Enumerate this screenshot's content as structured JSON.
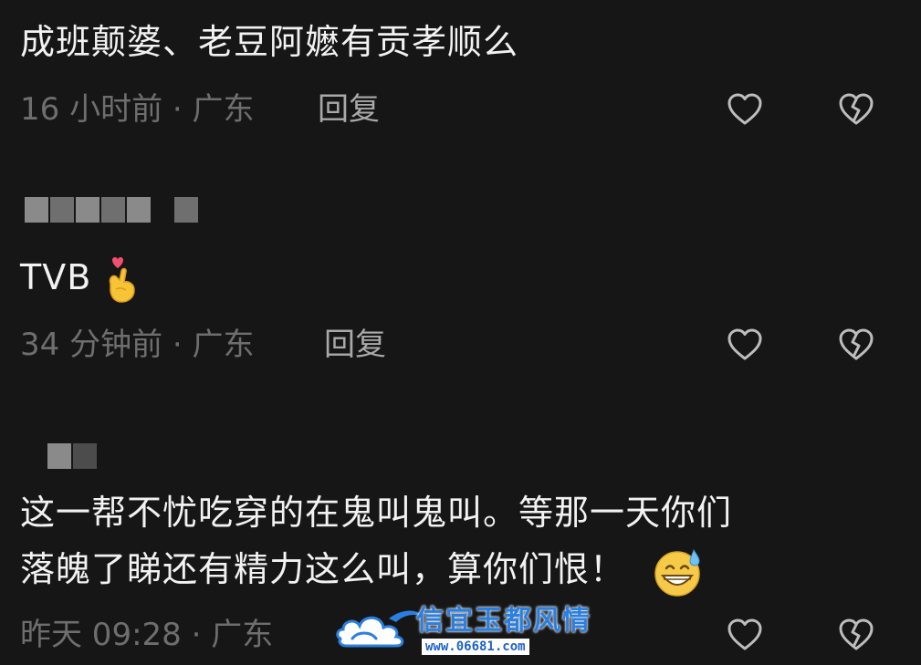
{
  "comments": [
    {
      "text": "成班颠婆、老豆阿嬷有贡孝顺么",
      "meta": "16 小时前 · 广东",
      "reply_label": "回复"
    },
    {
      "text": "TVB",
      "emoji": "heart-finger-emoji",
      "meta": "34 分钟前 · 广东",
      "reply_label": "回复"
    },
    {
      "text_line1": "这一帮不忧吃穿的在鬼叫鬼叫。等那一天你们",
      "text_line2": "落魄了睇还有精力这么叫，算你们恨！",
      "emoji": "grinning-sweat-emoji",
      "meta": "昨天 09:28 · 广东"
    }
  ],
  "watermark": {
    "title": "信宜玉都风情",
    "url": "www.06681.com"
  },
  "icons": {
    "like": "heart-outline-icon",
    "dislike": "broken-heart-icon"
  },
  "colors": {
    "background": "#161616",
    "text": "#f2f2f2",
    "meta": "#6e6e6e",
    "reply": "#a9a9a9",
    "icon": "#bdbdbd",
    "watermark": "#2a7fe0"
  }
}
